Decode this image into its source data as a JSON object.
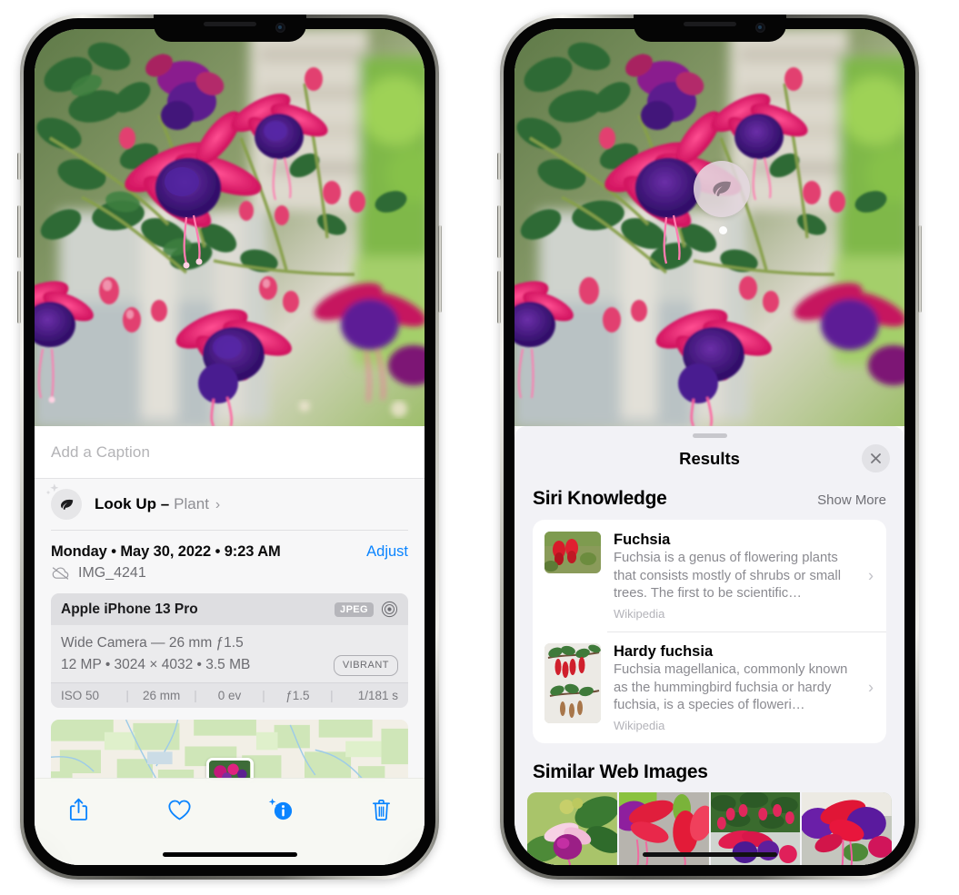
{
  "colors": {
    "accent_blue": "#0a84ff",
    "sheet_bg": "#f2f2f6",
    "card_bg": "#ffffff",
    "secondary_text": "#8a8a90",
    "meta_card": "#ebebed"
  },
  "left_phone": {
    "name": "photos-detail-view",
    "caption": {
      "placeholder": "Add a Caption",
      "value": ""
    },
    "lookup": {
      "icon": "leaf-icon",
      "sparkle_icon": "sparkles-icon",
      "label": "Look Up –",
      "subject": "Plant",
      "chevron": "›"
    },
    "info": {
      "datetime": "Monday • May 30, 2022 • 9:23 AM",
      "adjust_label": "Adjust",
      "cloud_icon": "icloud-slash-icon",
      "filename": "IMG_4241"
    },
    "metadata": {
      "device": "Apple iPhone 13 Pro",
      "format_tag": "JPEG",
      "lens_icon": "lens-icon",
      "lens_line": "Wide Camera — 26 mm ƒ1.5",
      "size_line": "12 MP • 3024 × 4032 • 3.5 MB",
      "style_tag": "VIBRANT",
      "exif": [
        {
          "label": "ISO 50"
        },
        {
          "label": "26 mm"
        },
        {
          "label": "0 ev"
        },
        {
          "label": "ƒ1.5"
        },
        {
          "label": "1/181 s"
        }
      ],
      "exif_separator": "|"
    },
    "toolbar": {
      "share_label": "share-icon",
      "favorite_label": "heart-icon",
      "info_label": "info-sparkle-icon",
      "delete_label": "trash-icon"
    }
  },
  "right_phone": {
    "name": "visual-look-up-results",
    "badge": {
      "icon": "leaf-icon"
    },
    "sheet": {
      "title": "Results",
      "close_icon": "close-icon",
      "grabber": "drag-handle"
    },
    "siri_knowledge": {
      "title": "Siri Knowledge",
      "show_more": "Show More",
      "items": [
        {
          "title": "Fuchsia",
          "description": "Fuchsia is a genus of flowering plants that consists mostly of shrubs or small trees. The first to be scientific…",
          "source": "Wikipedia",
          "chevron": "›"
        },
        {
          "title": "Hardy fuchsia",
          "description": "Fuchsia magellanica, commonly known as the hummingbird fuchsia or hardy fuchsia, is a species of floweri…",
          "source": "Wikipedia",
          "chevron": "›"
        }
      ]
    },
    "similar_web_images": {
      "title": "Similar Web Images",
      "thumbnails": [
        {
          "alt": "fuchsia-thumb-1"
        },
        {
          "alt": "fuchsia-thumb-2"
        },
        {
          "alt": "fuchsia-thumb-3"
        },
        {
          "alt": "fuchsia-thumb-4"
        }
      ]
    }
  }
}
